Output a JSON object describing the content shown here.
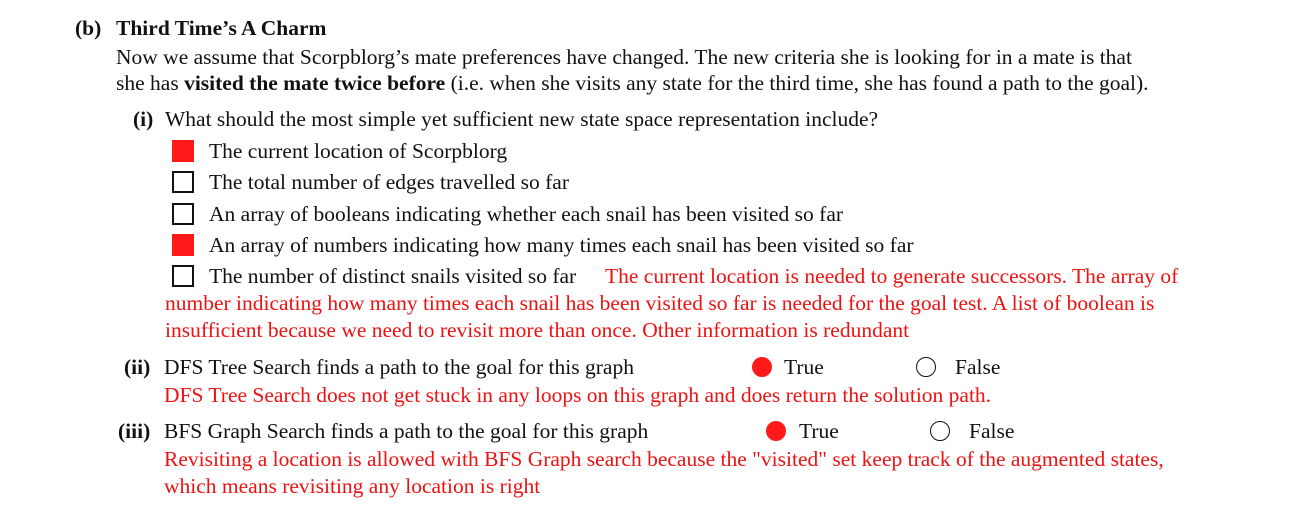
{
  "part": {
    "label": "(b)",
    "title": "Third Time’s A Charm",
    "intro_line1": "Now we assume that Scorpblorg’s mate preferences have changed. The new criteria she is looking for in a mate is that",
    "intro_line2_pre": "she has ",
    "intro_line2_bold": "visited the mate twice before",
    "intro_line2_post": " (i.e. when she visits any state for the third time, she has found a path to the goal)."
  },
  "q1": {
    "label": "(i)",
    "question": "What should the most simple yet sufficient new state space representation include?",
    "options": [
      {
        "text": "The current location of Scorpblorg",
        "checked": true
      },
      {
        "text": "The total number of edges travelled so far",
        "checked": false
      },
      {
        "text": "An array of booleans indicating whether each snail has been visited so far",
        "checked": false
      },
      {
        "text": "An array of numbers indicating how many times each snail has been visited so far",
        "checked": true
      },
      {
        "text": "The number of distinct snails visited so far",
        "checked": false
      }
    ],
    "explanation_line1": "The current location is needed to generate successors. The array of",
    "explanation_line2": "number indicating how many times each snail has been visited so far is needed for the goal test. A list of boolean is",
    "explanation_line3": "insufficient because we need to revisit more than once. Other information is redundant"
  },
  "q2": {
    "label": "(ii)",
    "question": "DFS Tree Search finds a path to the goal for this graph",
    "true_label": "True",
    "false_label": "False",
    "selected": "True",
    "explanation": "DFS Tree Search does not get stuck in any loops on this graph and does return the solution path."
  },
  "q3": {
    "label": "(iii)",
    "question": "BFS Graph Search finds a path to the goal for this graph",
    "true_label": "True",
    "false_label": "False",
    "selected": "True",
    "explanation_line1": "Revisiting a location is allowed with BFS Graph search because the \"visited\" set keep track of the augmented states,",
    "explanation_line2": "which means revisiting any location is right"
  },
  "colors": {
    "answer_red": "#ee1111",
    "fill_red": "#ff1a1a",
    "text": "#111111"
  }
}
